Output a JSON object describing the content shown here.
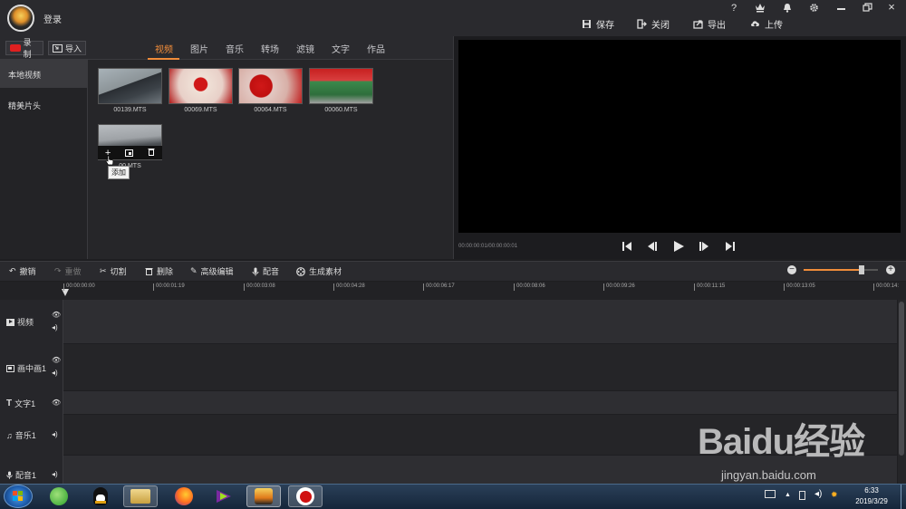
{
  "titlebar": {
    "login": "登录",
    "actions": [
      "保存",
      "关闭",
      "导出",
      "上传"
    ],
    "window_controls": [
      "?",
      "vip-icon",
      "bell-icon",
      "gear-icon",
      "restore-icon",
      "×"
    ]
  },
  "media": {
    "record_label": "录制",
    "import_label": "导入",
    "tabs": [
      "视频",
      "图片",
      "音乐",
      "转场",
      "滤镜",
      "文字",
      "作品"
    ],
    "active_tab": "视频",
    "sidebar": [
      "本地视频",
      "精美片头"
    ],
    "thumbnails": [
      "00139.MTS",
      "00069.MTS",
      "00064.MTS",
      "00060.MTS",
      "00.MTS"
    ],
    "tooltip": "添加"
  },
  "preview": {
    "timecode": "00:00:00:01/00:00:00:01"
  },
  "editbar": {
    "undo": "撤销",
    "redo": "重做",
    "cut": "切割",
    "delete": "删除",
    "advanced": "高级编辑",
    "dub": "配音",
    "generate": "生成素材",
    "zoom_level": 0.78
  },
  "ruler": [
    "00:00:00:00",
    "00:00:01:19",
    "00:00:03:08",
    "00:00:04:28",
    "00:00:06:17",
    "00:00:08:06",
    "00:00:09:26",
    "00:00:11:15",
    "00:00:13:05",
    "00:00:14:"
  ],
  "tracks": [
    "视频",
    "画中画1",
    "文字1",
    "音乐1",
    "配音1"
  ],
  "taskbar": {
    "time": "6:33",
    "date": "2019/3/29"
  },
  "watermark": {
    "logo": "Baidu经验",
    "url": "jingyan.baidu.com"
  },
  "colors": {
    "accent": "#f08c3a",
    "record_red": "#e02020"
  }
}
